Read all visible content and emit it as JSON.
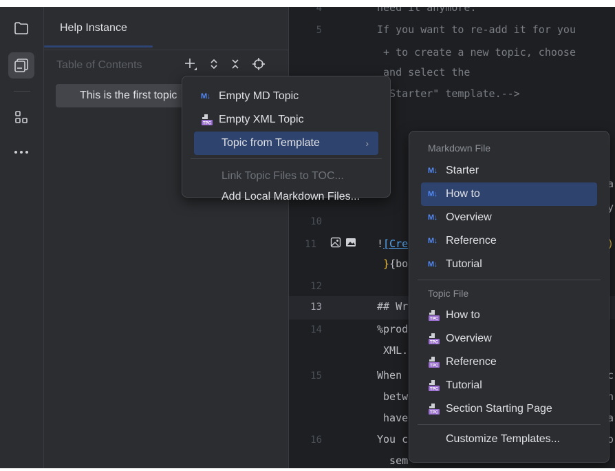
{
  "activity_bar": {
    "items": [
      "folder-icon",
      "toc-window-icon",
      "structure-icon",
      "more-icon"
    ]
  },
  "tool_window": {
    "title": "Help Instance",
    "toc_label": "Table of Contents",
    "toc_items": [
      {
        "label": "This is the first topic"
      }
    ]
  },
  "editor": {
    "lines": [
      {
        "num": "4",
        "text": "need it anymore."
      },
      {
        "num": "5",
        "text": "If you want to re-add it for you"
      },
      {
        "num": "",
        "text": " + to create a new topic, choose"
      },
      {
        "num": "",
        "text": " and select the"
      },
      {
        "num": "",
        "text": " \"Starter\" template.-->"
      },
      {
        "num": "10",
        "text": ""
      },
      {
        "num": "11",
        "text": "![Cre"
      },
      {
        "num": "",
        "text": " }{bo"
      },
      {
        "num": "12",
        "text": ""
      },
      {
        "num": "13",
        "text": "## Wr"
      },
      {
        "num": "14",
        "text": "%prod"
      },
      {
        "num": "",
        "text": " XML."
      },
      {
        "num": "15",
        "text": "When"
      },
      {
        "num": "",
        "text": " betw"
      },
      {
        "num": "",
        "text": " have"
      },
      {
        "num": "16",
        "text": "You c"
      },
      {
        "num": "",
        "text": "  sem"
      }
    ],
    "peek_right": [
      "a",
      "y",
      ")",
      "c",
      "h",
      "a",
      "o"
    ]
  },
  "context_menu": {
    "items": [
      {
        "label": "Empty MD Topic",
        "icon": "markdown-icon"
      },
      {
        "label": "Empty XML Topic",
        "icon": "tpc-file-icon"
      },
      {
        "label": "Topic from Template",
        "icon": "",
        "submenu": true
      },
      {
        "label": "Link Topic Files to TOC...",
        "icon": "",
        "disabled": true
      },
      {
        "label": "Add Local Markdown Files...",
        "icon": ""
      }
    ],
    "md_badge": "M↓",
    "submenu_arrow": "›"
  },
  "template_menu": {
    "markdown_header": "Markdown File",
    "markdown_items": [
      "Starter",
      "How to",
      "Overview",
      "Reference",
      "Tutorial"
    ],
    "topic_header": "Topic File",
    "topic_items": [
      "How to",
      "Overview",
      "Reference",
      "Tutorial",
      "Section Starting Page"
    ],
    "customize_label": "Customize Templates...",
    "selected": "How to"
  },
  "colors": {
    "accent": "#3574f0",
    "selection": "#2e436e",
    "markdown_icon": "#548af7",
    "tpc_icon": "#9b6fd2"
  }
}
